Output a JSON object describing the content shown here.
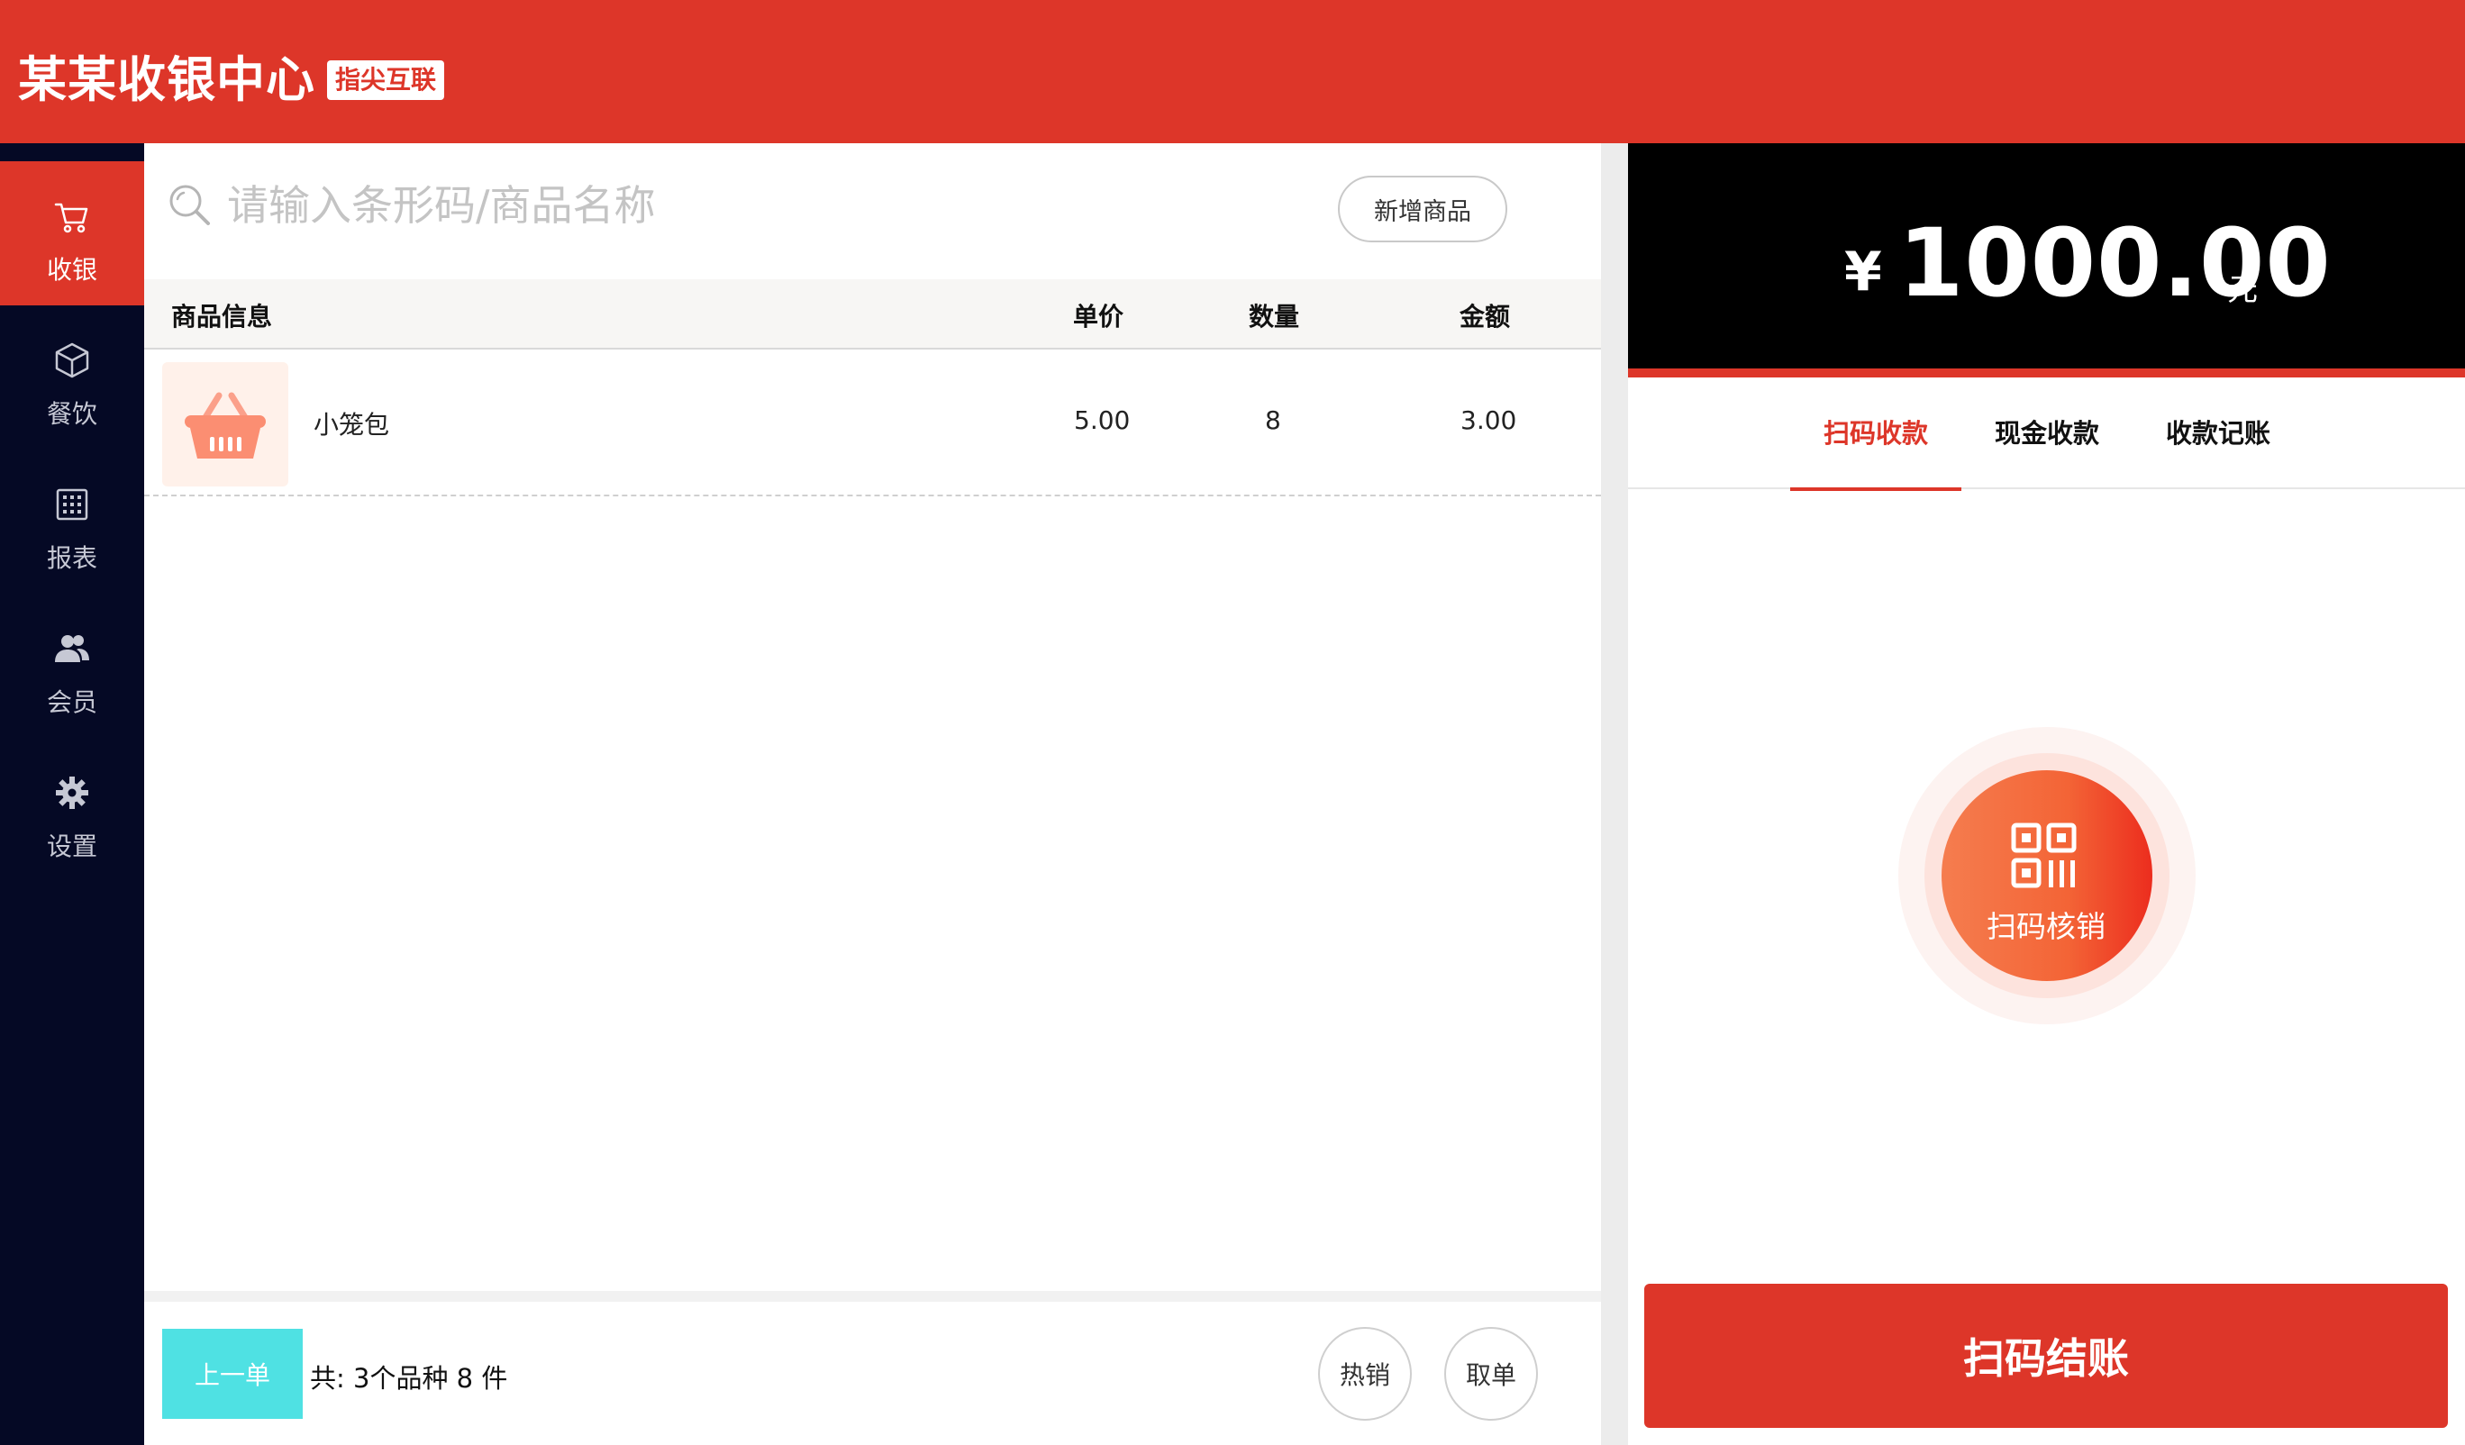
{
  "header": {
    "title": "某某收银中心",
    "badge": "指尖互联"
  },
  "sidebar": {
    "items": [
      {
        "label": "收银",
        "icon": "cart-icon",
        "active": true
      },
      {
        "label": "餐饮",
        "icon": "box-icon",
        "active": false
      },
      {
        "label": "报表",
        "icon": "grid-icon",
        "active": false
      },
      {
        "label": "会员",
        "icon": "users-icon",
        "active": false
      },
      {
        "label": "设置",
        "icon": "gear-icon",
        "active": false
      }
    ]
  },
  "search": {
    "placeholder": "请输入条形码/商品名称",
    "value": ""
  },
  "add_button": "新增商品",
  "table": {
    "columns": [
      "商品信息",
      "单价",
      "数量",
      "金额"
    ],
    "rows": [
      {
        "name": "小笼包",
        "price": "5.00",
        "qty": "8",
        "amount": "3.00",
        "icon": "basket-icon"
      }
    ]
  },
  "footer": {
    "prev_label": "上一单",
    "summary": "共: 3个品种 8 件",
    "hot_label": "热销",
    "cancel_label": "取单"
  },
  "payment": {
    "currency": "¥",
    "amount": "1000.00",
    "unit": "元",
    "tabs": [
      "扫码收款",
      "现金收款",
      "收款记账"
    ],
    "active_tab": 0,
    "scan_label": "扫码核销",
    "checkout_label": "扫码结账"
  },
  "colors": {
    "brand": "#dd3629",
    "sidebar_bg": "#050925",
    "prev_button": "#4fe1e3",
    "amount_bg": "#000000"
  }
}
